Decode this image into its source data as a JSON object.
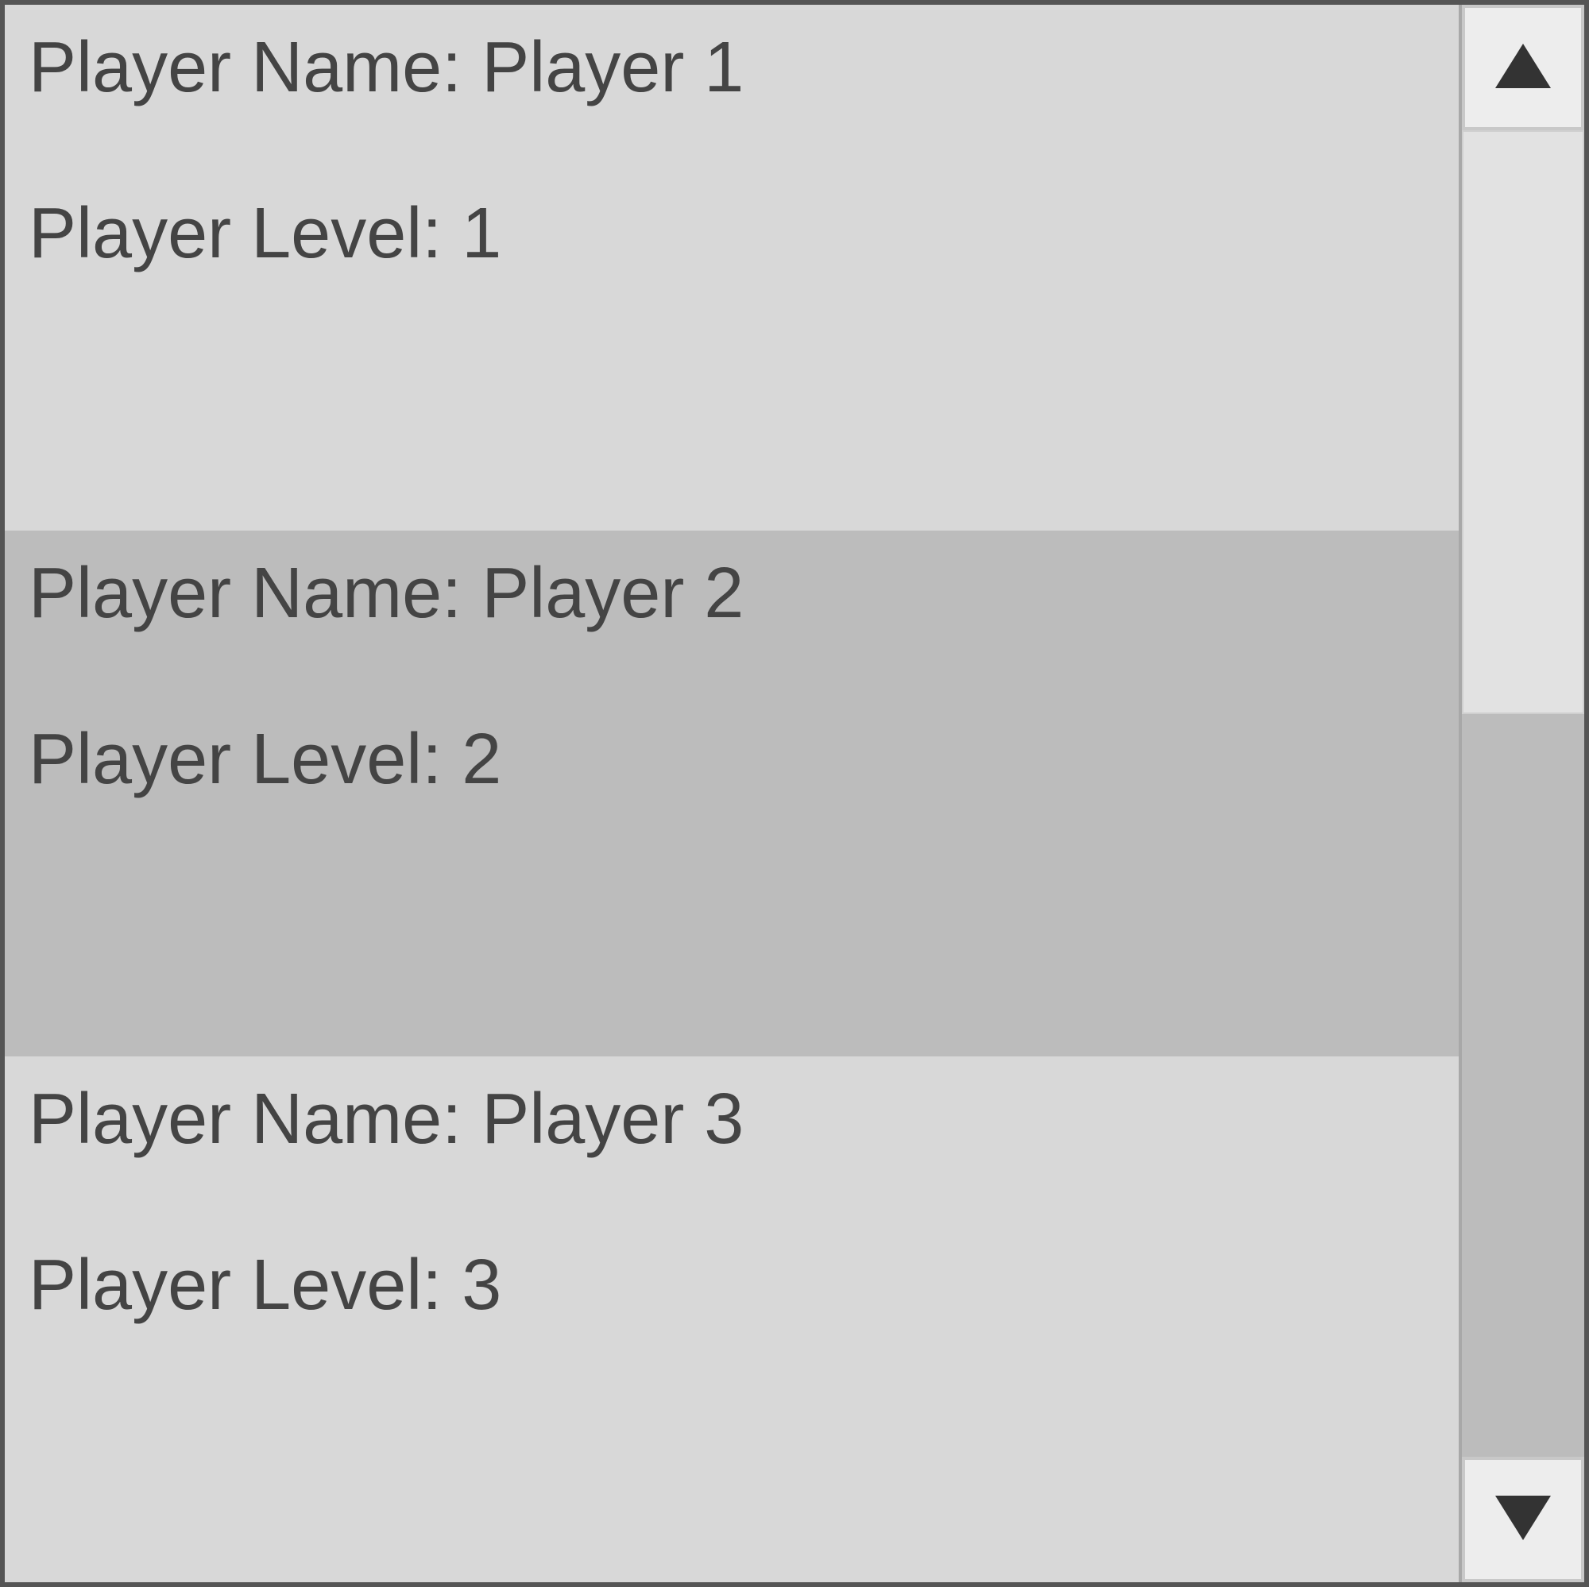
{
  "labels": {
    "name_prefix": "Player Name: ",
    "level_prefix": "Player Level: "
  },
  "players": [
    {
      "name": "Player 1",
      "level": "1"
    },
    {
      "name": "Player 2",
      "level": "2"
    },
    {
      "name": "Player 3",
      "level": "3"
    }
  ]
}
